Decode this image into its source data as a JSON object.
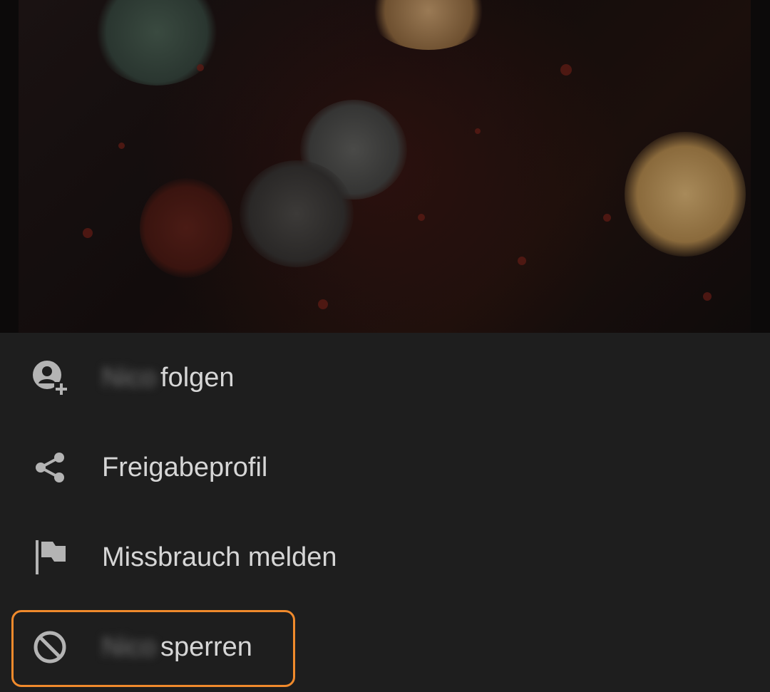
{
  "menu": {
    "items": [
      {
        "id": "follow",
        "icon": "add-user-icon",
        "name": "Nico",
        "label": "folgen"
      },
      {
        "id": "share",
        "icon": "share-icon",
        "label": "Freigabeprofil"
      },
      {
        "id": "report",
        "icon": "flag-icon",
        "label": "Missbrauch melden"
      },
      {
        "id": "block",
        "icon": "block-icon",
        "name": "Nico",
        "label": "sperren"
      }
    ],
    "highlighted_item": "block"
  },
  "colors": {
    "sheet_background": "#1e1e1e",
    "text": "#d6d6d6",
    "icon": "#b4b4b4",
    "highlight": "#f08a2c"
  }
}
